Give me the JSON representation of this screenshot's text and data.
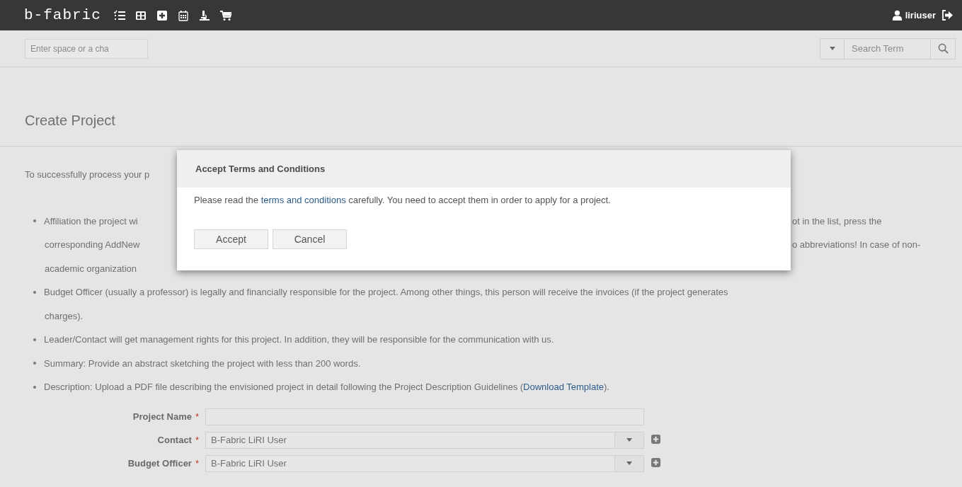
{
  "top_bar": {
    "logo": "b-fabric",
    "user": "liriuser"
  },
  "sub_bar": {
    "quick_field": {
      "placeholder": "Enter space or a cha"
    },
    "search": {
      "placeholder": "Search Term"
    }
  },
  "page_title": "Create Project",
  "content_lines": [
    {
      "kind": "paragraph",
      "text": "To successfully process your p"
    },
    {
      "kind": "bullet",
      "text": "Affiliation the project wi",
      "right": "ot in the list, press the"
    },
    {
      "kind": "continuation",
      "text": "corresponding AddNew",
      "right": "o abbreviations! In case of non-"
    },
    {
      "kind": "continuation",
      "text": "academic organization"
    },
    {
      "kind": "bullet",
      "text": "Budget Officer (usually a professor) is legally and financially responsible for the project. Among other things, this person will receive the invoices (if the project generates"
    },
    {
      "kind": "continuation",
      "text": "charges)."
    },
    {
      "kind": "bullet",
      "text": "Leader/Contact will get management rights for this project. In addition, they will be responsible for the communication with us."
    },
    {
      "kind": "bullet",
      "text": "Summary: Provide an abstract sketching the project with less than 200 words."
    },
    {
      "kind": "bullet",
      "text": "Description: Upload a PDF file describing the envisioned project in detail following the Project Description Guidelines (",
      "link": "Download Template",
      "after": ")."
    }
  ],
  "form_fields": [
    {
      "label": "Project Name",
      "required_mark": "*",
      "kind": "text"
    },
    {
      "label": "Contact",
      "required_mark": "*",
      "kind": "select",
      "value": "B-Fabric LiRI User"
    },
    {
      "label": "Budget Officer",
      "required_mark": "*",
      "kind": "select",
      "value": "B-Fabric LiRI User"
    }
  ],
  "modal": {
    "title": "Accept Terms and Conditions",
    "message_before": "Please read the ",
    "link": "terms and conditions",
    "message_after": " carefully. You need to accept them in order to apply for a project.",
    "buttons": [
      "Accept",
      "Cancel"
    ]
  }
}
